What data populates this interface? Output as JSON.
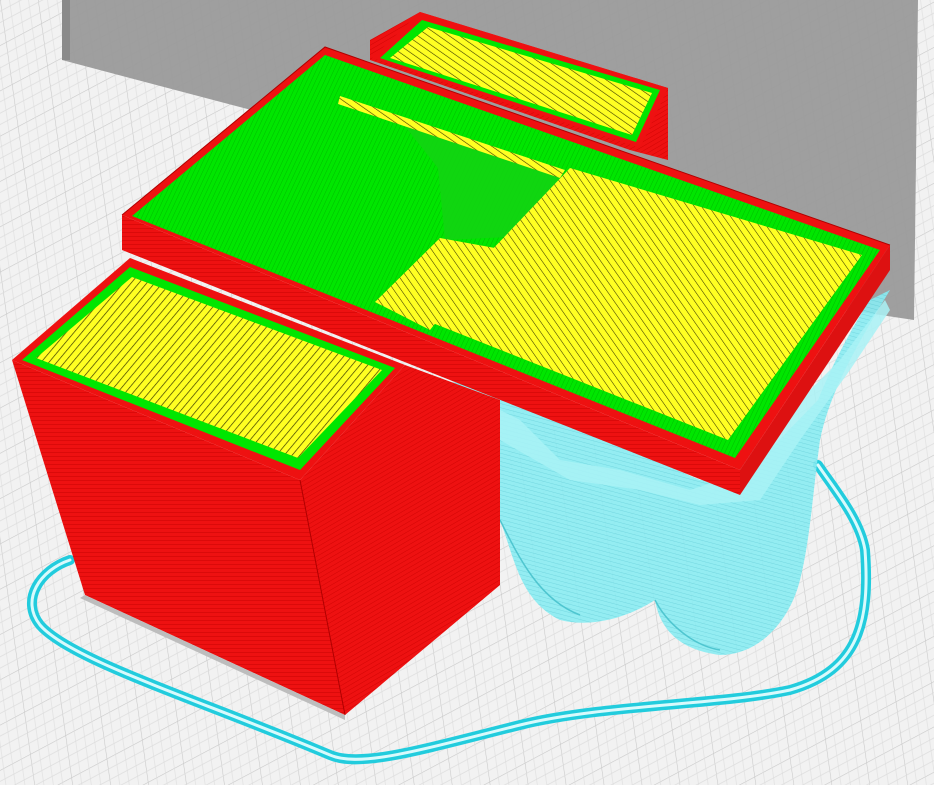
{
  "viewer": {
    "kind": "slicer-layer-preview",
    "background_color": "#f2f2f2",
    "grid_color": "#c8c8c8",
    "build_volume_shadow_color": "#9a9a9a",
    "colors": {
      "outer_wall": "#ee1111",
      "inner_wall": "#00e600",
      "top_bottom_skin": "#ffff22",
      "support": "#7fe8f0",
      "skirt": "#22ccdd"
    }
  }
}
